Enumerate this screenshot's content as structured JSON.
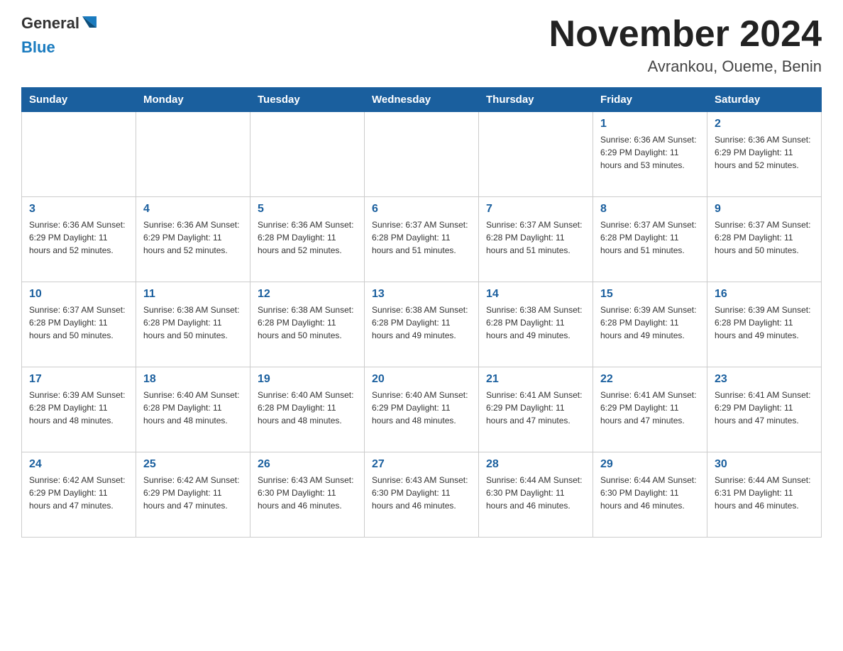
{
  "header": {
    "logo_general": "General",
    "logo_blue": "Blue",
    "month_year": "November 2024",
    "location": "Avrankou, Oueme, Benin"
  },
  "days_of_week": [
    "Sunday",
    "Monday",
    "Tuesday",
    "Wednesday",
    "Thursday",
    "Friday",
    "Saturday"
  ],
  "weeks": [
    [
      {
        "day": "",
        "info": ""
      },
      {
        "day": "",
        "info": ""
      },
      {
        "day": "",
        "info": ""
      },
      {
        "day": "",
        "info": ""
      },
      {
        "day": "",
        "info": ""
      },
      {
        "day": "1",
        "info": "Sunrise: 6:36 AM\nSunset: 6:29 PM\nDaylight: 11 hours and 53 minutes."
      },
      {
        "day": "2",
        "info": "Sunrise: 6:36 AM\nSunset: 6:29 PM\nDaylight: 11 hours and 52 minutes."
      }
    ],
    [
      {
        "day": "3",
        "info": "Sunrise: 6:36 AM\nSunset: 6:29 PM\nDaylight: 11 hours and 52 minutes."
      },
      {
        "day": "4",
        "info": "Sunrise: 6:36 AM\nSunset: 6:29 PM\nDaylight: 11 hours and 52 minutes."
      },
      {
        "day": "5",
        "info": "Sunrise: 6:36 AM\nSunset: 6:28 PM\nDaylight: 11 hours and 52 minutes."
      },
      {
        "day": "6",
        "info": "Sunrise: 6:37 AM\nSunset: 6:28 PM\nDaylight: 11 hours and 51 minutes."
      },
      {
        "day": "7",
        "info": "Sunrise: 6:37 AM\nSunset: 6:28 PM\nDaylight: 11 hours and 51 minutes."
      },
      {
        "day": "8",
        "info": "Sunrise: 6:37 AM\nSunset: 6:28 PM\nDaylight: 11 hours and 51 minutes."
      },
      {
        "day": "9",
        "info": "Sunrise: 6:37 AM\nSunset: 6:28 PM\nDaylight: 11 hours and 50 minutes."
      }
    ],
    [
      {
        "day": "10",
        "info": "Sunrise: 6:37 AM\nSunset: 6:28 PM\nDaylight: 11 hours and 50 minutes."
      },
      {
        "day": "11",
        "info": "Sunrise: 6:38 AM\nSunset: 6:28 PM\nDaylight: 11 hours and 50 minutes."
      },
      {
        "day": "12",
        "info": "Sunrise: 6:38 AM\nSunset: 6:28 PM\nDaylight: 11 hours and 50 minutes."
      },
      {
        "day": "13",
        "info": "Sunrise: 6:38 AM\nSunset: 6:28 PM\nDaylight: 11 hours and 49 minutes."
      },
      {
        "day": "14",
        "info": "Sunrise: 6:38 AM\nSunset: 6:28 PM\nDaylight: 11 hours and 49 minutes."
      },
      {
        "day": "15",
        "info": "Sunrise: 6:39 AM\nSunset: 6:28 PM\nDaylight: 11 hours and 49 minutes."
      },
      {
        "day": "16",
        "info": "Sunrise: 6:39 AM\nSunset: 6:28 PM\nDaylight: 11 hours and 49 minutes."
      }
    ],
    [
      {
        "day": "17",
        "info": "Sunrise: 6:39 AM\nSunset: 6:28 PM\nDaylight: 11 hours and 48 minutes."
      },
      {
        "day": "18",
        "info": "Sunrise: 6:40 AM\nSunset: 6:28 PM\nDaylight: 11 hours and 48 minutes."
      },
      {
        "day": "19",
        "info": "Sunrise: 6:40 AM\nSunset: 6:28 PM\nDaylight: 11 hours and 48 minutes."
      },
      {
        "day": "20",
        "info": "Sunrise: 6:40 AM\nSunset: 6:29 PM\nDaylight: 11 hours and 48 minutes."
      },
      {
        "day": "21",
        "info": "Sunrise: 6:41 AM\nSunset: 6:29 PM\nDaylight: 11 hours and 47 minutes."
      },
      {
        "day": "22",
        "info": "Sunrise: 6:41 AM\nSunset: 6:29 PM\nDaylight: 11 hours and 47 minutes."
      },
      {
        "day": "23",
        "info": "Sunrise: 6:41 AM\nSunset: 6:29 PM\nDaylight: 11 hours and 47 minutes."
      }
    ],
    [
      {
        "day": "24",
        "info": "Sunrise: 6:42 AM\nSunset: 6:29 PM\nDaylight: 11 hours and 47 minutes."
      },
      {
        "day": "25",
        "info": "Sunrise: 6:42 AM\nSunset: 6:29 PM\nDaylight: 11 hours and 47 minutes."
      },
      {
        "day": "26",
        "info": "Sunrise: 6:43 AM\nSunset: 6:30 PM\nDaylight: 11 hours and 46 minutes."
      },
      {
        "day": "27",
        "info": "Sunrise: 6:43 AM\nSunset: 6:30 PM\nDaylight: 11 hours and 46 minutes."
      },
      {
        "day": "28",
        "info": "Sunrise: 6:44 AM\nSunset: 6:30 PM\nDaylight: 11 hours and 46 minutes."
      },
      {
        "day": "29",
        "info": "Sunrise: 6:44 AM\nSunset: 6:30 PM\nDaylight: 11 hours and 46 minutes."
      },
      {
        "day": "30",
        "info": "Sunrise: 6:44 AM\nSunset: 6:31 PM\nDaylight: 11 hours and 46 minutes."
      }
    ]
  ]
}
